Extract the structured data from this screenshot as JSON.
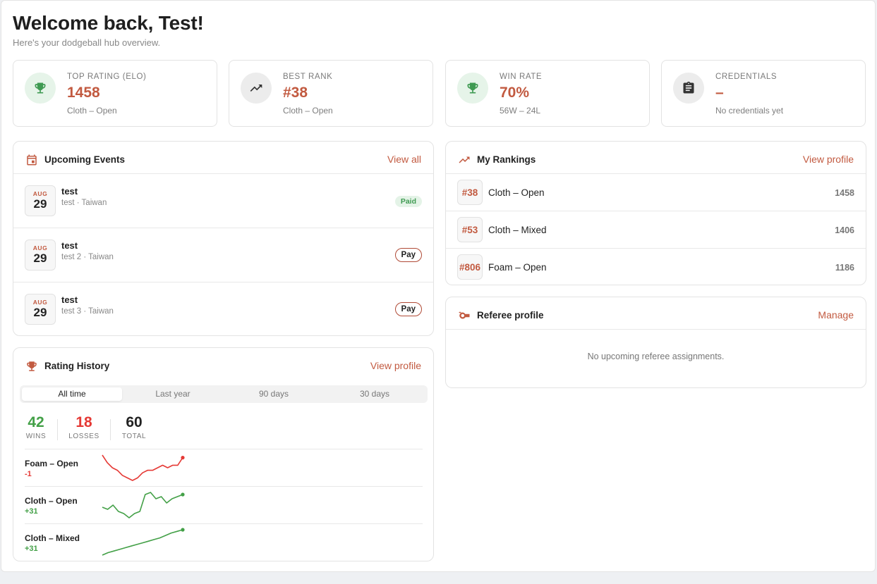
{
  "header": {
    "title": "Welcome back, Test!",
    "subtitle": "Here's your dodgeball hub overview."
  },
  "stats": [
    {
      "label": "TOP RATING (ELO)",
      "value": "1458",
      "sub": "Cloth – Open",
      "icon": "trophy-icon"
    },
    {
      "label": "BEST RANK",
      "value": "#38",
      "sub": "Cloth – Open",
      "icon": "trending-up-icon"
    },
    {
      "label": "WIN RATE",
      "value": "70%",
      "sub": "56W – 24L",
      "icon": "trophy-icon"
    },
    {
      "label": "CREDENTIALS",
      "value": "–",
      "sub": "No credentials yet",
      "icon": "clipboard-icon"
    }
  ],
  "events": {
    "title": "Upcoming Events",
    "link": "View all",
    "items": [
      {
        "month": "AUG",
        "day": "29",
        "name": "test",
        "meta": "test · Taiwan",
        "status": "Paid"
      },
      {
        "month": "AUG",
        "day": "29",
        "name": "test",
        "meta": "test 2 · Taiwan",
        "action": "Pay"
      },
      {
        "month": "AUG",
        "day": "29",
        "name": "test",
        "meta": "test 3 · Taiwan",
        "action": "Pay"
      }
    ]
  },
  "rankings": {
    "title": "My Rankings",
    "link": "View profile",
    "items": [
      {
        "rank": "#38",
        "name": "Cloth – Open",
        "score": "1458"
      },
      {
        "rank": "#53",
        "name": "Cloth – Mixed",
        "score": "1406"
      },
      {
        "rank": "#806",
        "name": "Foam – Open",
        "score": "1186"
      }
    ]
  },
  "referee": {
    "title": "Referee profile",
    "link": "Manage",
    "empty": "No upcoming referee assignments."
  },
  "history": {
    "title": "Rating History",
    "link": "View profile",
    "tabs": [
      "All time",
      "Last year",
      "90 days",
      "30 days"
    ],
    "active_tab": 0,
    "tally": {
      "wins": "42",
      "wins_label": "WINS",
      "losses": "18",
      "losses_label": "LOSSES",
      "total": "60",
      "total_label": "TOTAL"
    },
    "series": [
      {
        "name": "Foam – Open",
        "delta": "-1",
        "trend": "down",
        "values": [
          1187,
          1184,
          1182,
          1181,
          1179,
          1178,
          1177,
          1178,
          1180,
          1181,
          1181,
          1182,
          1183,
          1182,
          1183,
          1183,
          1186
        ]
      },
      {
        "name": "Cloth – Open",
        "delta": "+31",
        "trend": "up",
        "values": [
          1427,
          1426,
          1428,
          1425,
          1424,
          1422,
          1424,
          1425,
          1433,
          1434,
          1431,
          1432,
          1429,
          1431,
          1432,
          1433
        ]
      },
      {
        "name": "Cloth – Mixed",
        "delta": "+31",
        "trend": "up",
        "values": [
          1375,
          1378,
          1380,
          1382,
          1384,
          1386,
          1388,
          1390,
          1392,
          1394,
          1396,
          1399,
          1402,
          1404,
          1406
        ]
      }
    ]
  },
  "colors": {
    "accent": "#c25a40",
    "win": "#43a047",
    "loss": "#e53935",
    "spark_down": "#e53935",
    "spark_up": "#43a047"
  }
}
